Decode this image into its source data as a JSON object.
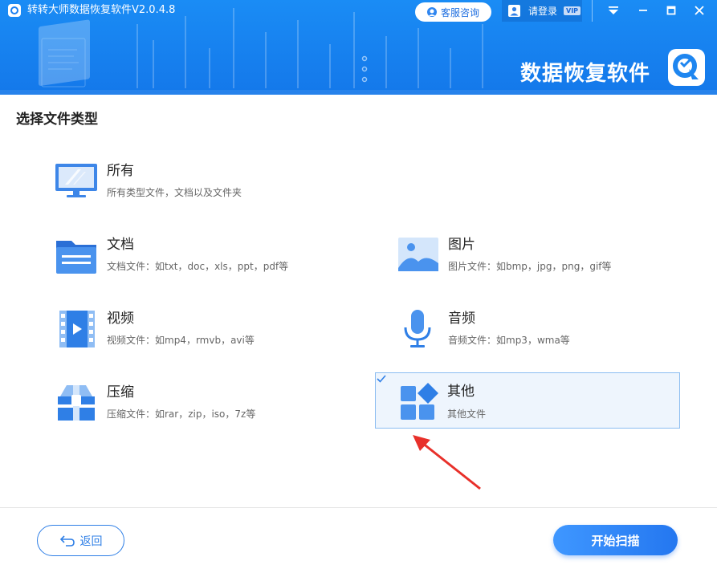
{
  "window": {
    "title": "转转大师数据恢复软件V2.0.4.8",
    "service_label": "客服咨询",
    "login_label": "请登录",
    "vip_label": "VIP"
  },
  "banner": {
    "brand_text": "数据恢复软件"
  },
  "main": {
    "section_title": "选择文件类型",
    "options": [
      {
        "name": "所有",
        "desc": "所有类型文件，文档以及文件夹",
        "icon": "monitor-icon",
        "selected": false
      },
      {
        "name": "文档",
        "desc": "文档文件：如txt，doc，xls，ppt，pdf等",
        "icon": "folder-icon",
        "selected": false
      },
      {
        "name": "图片",
        "desc": "图片文件：如bmp，jpg，png，gif等",
        "icon": "image-icon",
        "selected": false
      },
      {
        "name": "视频",
        "desc": "视频文件：如mp4，rmvb，avi等",
        "icon": "video-icon",
        "selected": false
      },
      {
        "name": "音频",
        "desc": "音频文件：如mp3，wma等",
        "icon": "microphone-icon",
        "selected": false
      },
      {
        "name": "压缩",
        "desc": "压缩文件：如rar，zip，iso，7z等",
        "icon": "archive-icon",
        "selected": false
      },
      {
        "name": "其他",
        "desc": "其他文件",
        "icon": "apps-icon",
        "selected": true
      }
    ]
  },
  "footer": {
    "back_label": "返回",
    "scan_label": "开始扫描"
  },
  "colors": {
    "header_blue": "#1a8cf5",
    "accent_blue": "#2f7fe6",
    "selected_bg": "#eef5fd",
    "selected_border": "#8bbcf1",
    "arrow_red": "#e8302a"
  }
}
